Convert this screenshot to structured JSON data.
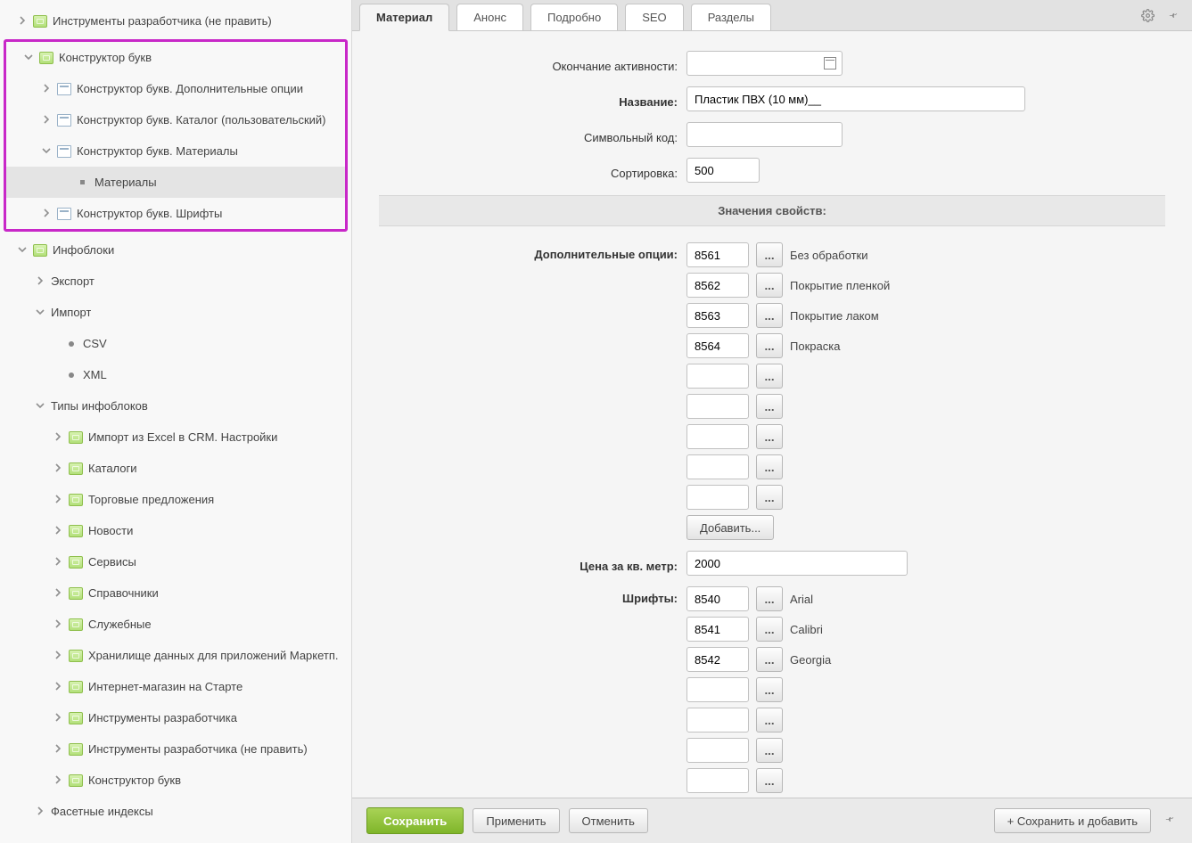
{
  "sidebar": {
    "items": [
      {
        "level": 0,
        "arrow": "right",
        "icon": "iblock",
        "label": "Инструменты разработчика (не править)"
      }
    ],
    "highlight": {
      "header": {
        "level": 0,
        "arrow": "down",
        "icon": "iblock",
        "label": "Конструктор букв"
      },
      "children": [
        {
          "level": 1,
          "arrow": "right",
          "icon": "page",
          "label": "Конструктор букв. Дополнительные опции"
        },
        {
          "level": 1,
          "arrow": "right",
          "icon": "page",
          "label": "Конструктор букв. Каталог (пользовательский)"
        },
        {
          "level": 1,
          "arrow": "down",
          "icon": "page",
          "label": "Конструктор букв. Материалы"
        },
        {
          "level": 2,
          "arrow": "",
          "icon": "dot",
          "label": "Материалы",
          "selected": true
        },
        {
          "level": 1,
          "arrow": "right",
          "icon": "page",
          "label": "Конструктор букв. Шрифты"
        }
      ]
    },
    "rest": [
      {
        "level": 0,
        "arrow": "down",
        "icon": "iblock",
        "label": "Инфоблоки"
      },
      {
        "level": 1,
        "arrow": "right",
        "icon": "",
        "label": "Экспорт"
      },
      {
        "level": 1,
        "arrow": "down",
        "icon": "",
        "label": "Импорт"
      },
      {
        "level": 2,
        "arrow": "",
        "icon": "bullet",
        "label": "CSV"
      },
      {
        "level": 2,
        "arrow": "",
        "icon": "bullet",
        "label": "XML"
      },
      {
        "level": 1,
        "arrow": "down",
        "icon": "",
        "label": "Типы инфоблоков"
      },
      {
        "level": 2,
        "arrow": "right",
        "icon": "iblock",
        "label": "Импорт из Excel в CRM. Настройки"
      },
      {
        "level": 2,
        "arrow": "right",
        "icon": "iblock",
        "label": "Каталоги"
      },
      {
        "level": 2,
        "arrow": "right",
        "icon": "iblock",
        "label": "Торговые предложения"
      },
      {
        "level": 2,
        "arrow": "right",
        "icon": "iblock",
        "label": "Новости"
      },
      {
        "level": 2,
        "arrow": "right",
        "icon": "iblock",
        "label": "Сервисы"
      },
      {
        "level": 2,
        "arrow": "right",
        "icon": "iblock",
        "label": "Справочники"
      },
      {
        "level": 2,
        "arrow": "right",
        "icon": "iblock",
        "label": "Служебные"
      },
      {
        "level": 2,
        "arrow": "right",
        "icon": "iblock",
        "label": "Хранилище данных для приложений Маркетп."
      },
      {
        "level": 2,
        "arrow": "right",
        "icon": "iblock",
        "label": "Интернет-магазин на Старте"
      },
      {
        "level": 2,
        "arrow": "right",
        "icon": "iblock",
        "label": "Инструменты разработчика"
      },
      {
        "level": 2,
        "arrow": "right",
        "icon": "iblock",
        "label": "Инструменты разработчика (не править)"
      },
      {
        "level": 2,
        "arrow": "right",
        "icon": "iblock",
        "label": "Конструктор букв"
      },
      {
        "level": 1,
        "arrow": "right",
        "icon": "",
        "label": "Фасетные индексы"
      }
    ]
  },
  "tabs": [
    {
      "label": "Материал",
      "active": true
    },
    {
      "label": "Анонс"
    },
    {
      "label": "Подробно"
    },
    {
      "label": "SEO"
    },
    {
      "label": "Разделы"
    }
  ],
  "form": {
    "labels": {
      "activity_end": "Окончание активности:",
      "name": "Название:",
      "symbolic_code": "Символьный код:",
      "sort": "Сортировка:",
      "section_header": "Значения свойств:",
      "extra_options": "Дополнительные опции:",
      "price": "Цена за кв. метр:",
      "fonts": "Шрифты:",
      "add": "Добавить...",
      "pick": "..."
    },
    "values": {
      "name": "Пластик ПВХ (10 мм)__",
      "symbolic_code": "",
      "sort": "500",
      "price": "2000"
    },
    "extra_options": [
      {
        "id": "8561",
        "name": "Без обработки"
      },
      {
        "id": "8562",
        "name": "Покрытие пленкой"
      },
      {
        "id": "8563",
        "name": "Покрытие лаком"
      },
      {
        "id": "8564",
        "name": "Покраска"
      },
      {
        "id": "",
        "name": ""
      },
      {
        "id": "",
        "name": ""
      },
      {
        "id": "",
        "name": ""
      },
      {
        "id": "",
        "name": ""
      },
      {
        "id": "",
        "name": ""
      }
    ],
    "fonts": [
      {
        "id": "8540",
        "name": "Arial"
      },
      {
        "id": "8541",
        "name": "Calibri"
      },
      {
        "id": "8542",
        "name": "Georgia"
      },
      {
        "id": "",
        "name": ""
      },
      {
        "id": "",
        "name": ""
      },
      {
        "id": "",
        "name": ""
      },
      {
        "id": "",
        "name": ""
      }
    ]
  },
  "footer": {
    "save": "Сохранить",
    "apply": "Применить",
    "cancel": "Отменить",
    "save_add": "+  Сохранить и добавить"
  }
}
